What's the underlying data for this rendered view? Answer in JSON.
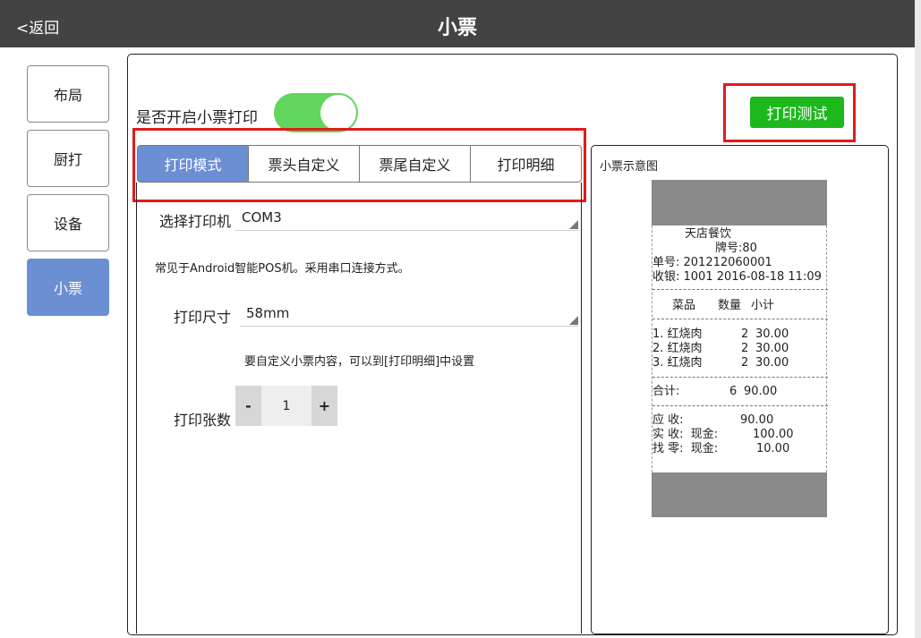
{
  "header": {
    "back_label": "<返回",
    "title": "小票"
  },
  "sidebar": {
    "items": [
      {
        "label": "布局",
        "active": false
      },
      {
        "label": "厨打",
        "active": false
      },
      {
        "label": "设备",
        "active": false
      },
      {
        "label": "小票",
        "active": true
      }
    ]
  },
  "settings": {
    "enable_label": "是否开启小票打印",
    "enabled": true,
    "test_button": "打印测试"
  },
  "tabs": [
    {
      "label": "打印模式",
      "active": true
    },
    {
      "label": "票头自定义",
      "active": false
    },
    {
      "label": "票尾自定义",
      "active": false
    },
    {
      "label": "打印明细",
      "active": false
    }
  ],
  "form": {
    "printer_label": "选择打印机",
    "printer_value": "COM3",
    "printer_hint": "常见于Android智能POS机。采用串口连接方式。",
    "size_label": "打印尺寸",
    "size_value": "58mm",
    "size_hint": "要自定义小票内容，可以到[打印明细]中设置",
    "copies_label": "打印张数",
    "copies_minus": "-",
    "copies_value": "1",
    "copies_plus": "+"
  },
  "preview": {
    "title": "小票示意图",
    "shop": "天店餐饮",
    "table_no": "牌号:80",
    "order_no": "单号: 201212060001",
    "cashier": "收银: 1001 2016-08-18 11:09",
    "col_item": "菜品",
    "col_qty": "数量",
    "col_subtotal": "小计",
    "items": [
      {
        "name": "1. 红烧肉",
        "qty": "2",
        "amount": "30.00"
      },
      {
        "name": "2. 红烧肉",
        "qty": "2",
        "amount": "30.00"
      },
      {
        "name": "3. 红烧肉",
        "qty": "2",
        "amount": "30.00"
      }
    ],
    "total_label": "合计:",
    "total_qty": "6",
    "total_amount": "90.00",
    "receivable_label": "应 收:",
    "receivable": "90.00",
    "paid_label": "实 收:  现金:",
    "paid": "100.00",
    "change_label": "找 零:  现金:",
    "change": "10.00"
  }
}
